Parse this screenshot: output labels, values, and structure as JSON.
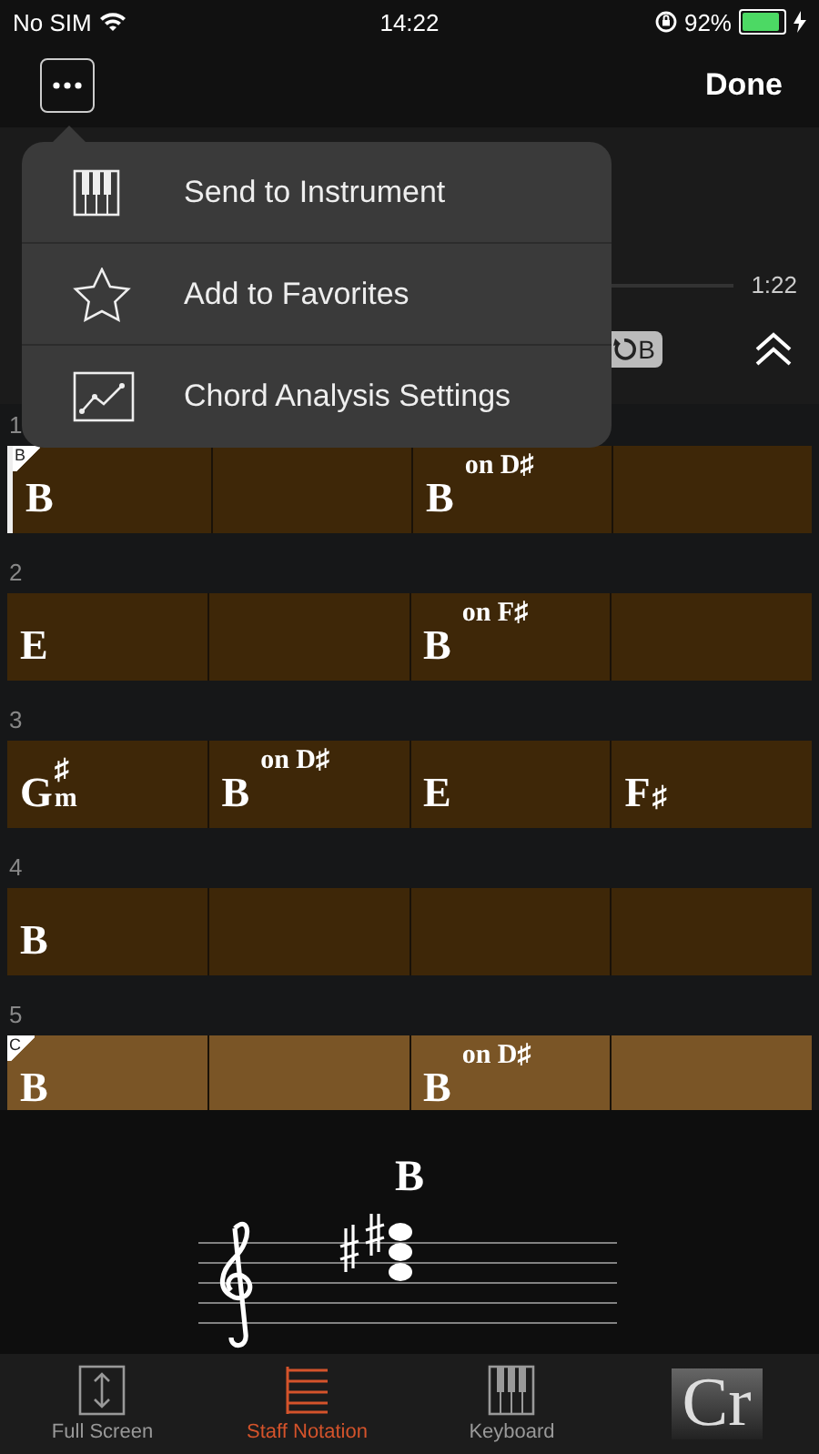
{
  "status_bar": {
    "carrier": "No SIM",
    "time": "14:22",
    "battery_text": "92%"
  },
  "nav": {
    "done": "Done"
  },
  "player": {
    "time": "1:22",
    "loop_badge": "B"
  },
  "menu": [
    {
      "kind": "keyboard",
      "label": "Send to Instrument"
    },
    {
      "kind": "star",
      "label": "Add to Favorites"
    },
    {
      "kind": "graph",
      "label": "Chord Analysis Settings"
    }
  ],
  "measures": [
    {
      "number": "1",
      "section": "B",
      "current": true,
      "highlighted": false,
      "chords": [
        {
          "kind": "chord",
          "root": "B"
        },
        {
          "kind": "blank"
        },
        {
          "kind": "chord",
          "root": "B",
          "bass": "on D♯"
        },
        {
          "kind": "blank"
        }
      ]
    },
    {
      "number": "2",
      "current": false,
      "highlighted": false,
      "chords": [
        {
          "kind": "chord",
          "root": "E"
        },
        {
          "kind": "blank"
        },
        {
          "kind": "chord",
          "root": "B",
          "bass": "on F♯"
        },
        {
          "kind": "blank"
        }
      ]
    },
    {
      "number": "3",
      "current": false,
      "highlighted": false,
      "chords": [
        {
          "kind": "chord",
          "root": "G",
          "accidental": "♯",
          "quality": "m"
        },
        {
          "kind": "chord",
          "root": "B",
          "bass": "on D♯"
        },
        {
          "kind": "chord",
          "root": "E"
        },
        {
          "kind": "chord",
          "root": "F",
          "accidental": "♯"
        }
      ]
    },
    {
      "number": "4",
      "current": false,
      "highlighted": false,
      "chords": [
        {
          "kind": "chord",
          "root": "B"
        },
        {
          "kind": "blank"
        },
        {
          "kind": "blank"
        },
        {
          "kind": "blank"
        }
      ]
    },
    {
      "number": "5",
      "section": "C",
      "current": false,
      "highlighted": true,
      "chords": [
        {
          "kind": "chord",
          "root": "B"
        },
        {
          "kind": "blank"
        },
        {
          "kind": "chord",
          "root": "B",
          "bass": "on D♯"
        },
        {
          "kind": "blank"
        }
      ]
    }
  ],
  "chord_display": {
    "name": "B"
  },
  "tabs": [
    {
      "kind": "fullscreen",
      "label": "Full Screen",
      "selected": false
    },
    {
      "kind": "staff",
      "label": "Staff Notation",
      "selected": true
    },
    {
      "kind": "keyboard",
      "label": "Keyboard",
      "selected": false
    },
    {
      "kind": "chart",
      "icon_text": "Cr",
      "selected": false
    }
  ]
}
